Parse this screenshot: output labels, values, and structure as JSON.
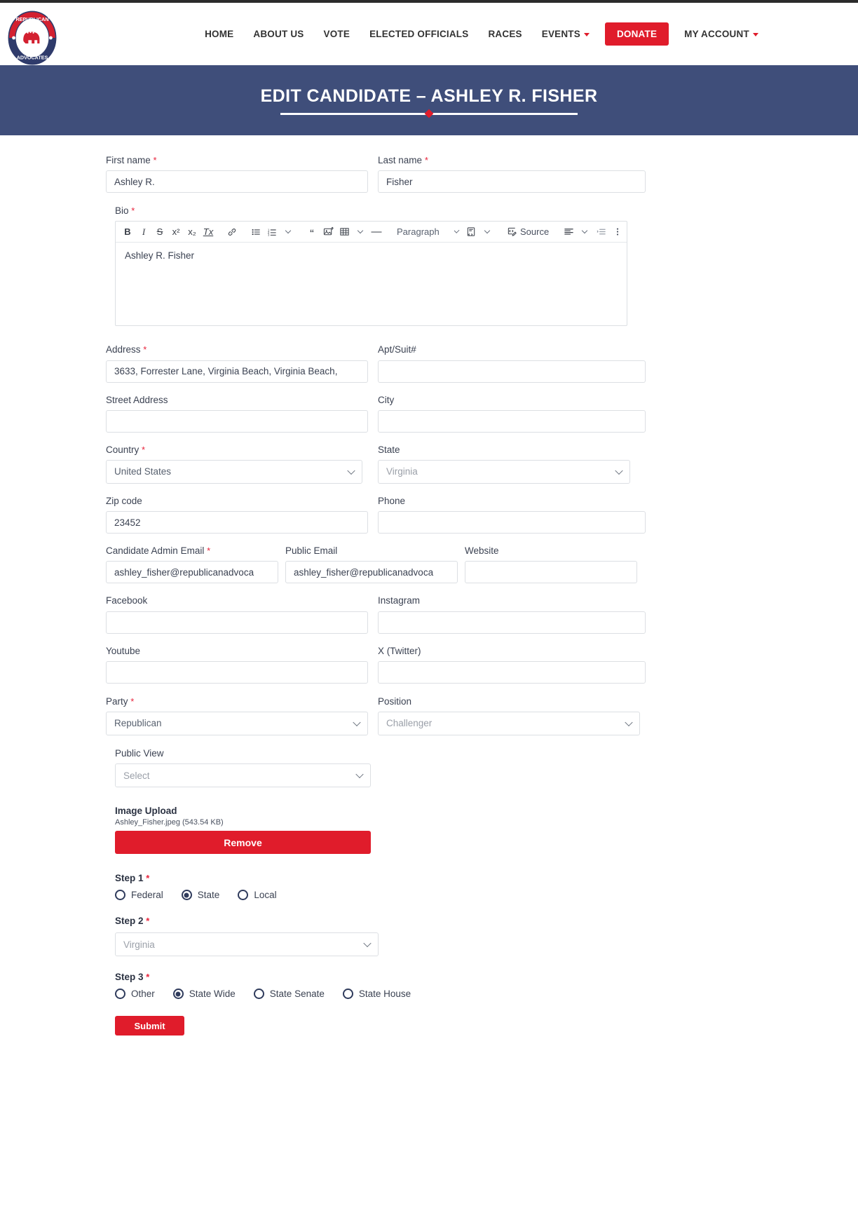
{
  "site": {
    "logo": {
      "top_text": "REPUBLICAN",
      "bottom_text": "ADVOCATES",
      "icon": "elephant-icon"
    },
    "nav": [
      {
        "label": "HOME",
        "has_caret": false
      },
      {
        "label": "ABOUT US",
        "has_caret": false
      },
      {
        "label": "VOTE",
        "has_caret": false
      },
      {
        "label": "ELECTED OFFICIALS",
        "has_caret": false
      },
      {
        "label": "RACES",
        "has_caret": false
      },
      {
        "label": "EVENTS",
        "has_caret": true
      },
      {
        "label": "DONATE",
        "has_caret": false,
        "style": "donate"
      },
      {
        "label": "MY ACCOUNT",
        "has_caret": true
      }
    ]
  },
  "banner": {
    "title": "EDIT CANDIDATE – ASHLEY R. FISHER",
    "bg_color": "#3f4e7a",
    "accent_color": "#e01c2b"
  },
  "form": {
    "first_name": {
      "label": "First name",
      "required": true,
      "value": "Ashley R."
    },
    "last_name": {
      "label": "Last name",
      "required": true,
      "value": "Fisher"
    },
    "bio": {
      "label": "Bio",
      "required": true,
      "content": "Ashley R. Fisher",
      "toolbar": {
        "buttons": [
          {
            "name": "bold-icon",
            "glyph": "B"
          },
          {
            "name": "italic-icon",
            "glyph": "I"
          },
          {
            "name": "strikethrough-icon",
            "glyph": "S"
          },
          {
            "name": "superscript-icon",
            "glyph": "x²"
          },
          {
            "name": "subscript-icon",
            "glyph": "x₂"
          },
          {
            "name": "remove-format-icon",
            "glyph": "Tx"
          },
          {
            "name": "link-icon",
            "glyph": "⧉"
          },
          {
            "name": "bulleted-list-icon",
            "glyph": "☰"
          },
          {
            "name": "numbered-list-icon",
            "glyph": "≣"
          },
          {
            "name": "list-options-chevron-icon",
            "glyph": "⌄"
          },
          {
            "name": "block-quote-icon",
            "glyph": "“"
          },
          {
            "name": "insert-image-icon",
            "glyph": "Ὓc"
          },
          {
            "name": "insert-table-icon",
            "glyph": "▦"
          },
          {
            "name": "table-options-chevron-icon",
            "glyph": "⌄"
          },
          {
            "name": "horizontal-line-icon",
            "glyph": "—"
          }
        ],
        "paragraph_dropdown": "Paragraph",
        "template_icon": "template-icon",
        "source_label": "Source",
        "alignment_icon": "text-align-icon",
        "indent_icon": "indent-icon",
        "more_options_icon": "vertical-dots-icon"
      }
    },
    "address": {
      "label": "Address",
      "required": true,
      "value": "3633, Forrester Lane, Virginia Beach, Virginia Beach,"
    },
    "apt": {
      "label": "Apt/Suit#",
      "required": false,
      "value": ""
    },
    "street_address": {
      "label": "Street Address",
      "required": false,
      "value": ""
    },
    "city": {
      "label": "City",
      "required": false,
      "value": ""
    },
    "country": {
      "label": "Country",
      "required": true,
      "value": "United States"
    },
    "state": {
      "label": "State",
      "required": false,
      "value": "Virginia",
      "muted": true
    },
    "zip": {
      "label": "Zip code",
      "required": false,
      "value": "23452"
    },
    "phone": {
      "label": "Phone",
      "required": false,
      "value": ""
    },
    "admin_email": {
      "label": "Candidate Admin Email",
      "required": true,
      "value": "ashley_fisher@republicanadvoca"
    },
    "public_email": {
      "label": "Public Email",
      "required": false,
      "value": "ashley_fisher@republicanadvoca"
    },
    "website": {
      "label": "Website",
      "required": false,
      "value": ""
    },
    "facebook": {
      "label": "Facebook",
      "required": false,
      "value": ""
    },
    "instagram": {
      "label": "Instagram",
      "required": false,
      "value": ""
    },
    "youtube": {
      "label": "Youtube",
      "required": false,
      "value": ""
    },
    "twitter": {
      "label": "X (Twitter)",
      "required": false,
      "value": ""
    },
    "party": {
      "label": "Party",
      "required": true,
      "value": "Republican"
    },
    "position": {
      "label": "Position",
      "required": false,
      "value": "Challenger",
      "muted": true
    },
    "public_view": {
      "label": "Public View",
      "required": false,
      "value": "Select",
      "muted": true
    },
    "image_upload": {
      "label": "Image Upload",
      "file_name": "Ashley_Fisher.jpeg (543.54 KB)",
      "remove_label": "Remove"
    },
    "step1": {
      "label": "Step 1",
      "required": true,
      "options": [
        {
          "label": "Federal",
          "checked": false
        },
        {
          "label": "State",
          "checked": true
        },
        {
          "label": "Local",
          "checked": false
        }
      ]
    },
    "step2": {
      "label": "Step 2",
      "required": true,
      "value": "Virginia",
      "muted": true
    },
    "step3": {
      "label": "Step 3",
      "required": true,
      "options": [
        {
          "label": "Other",
          "checked": false
        },
        {
          "label": "State Wide",
          "checked": true
        },
        {
          "label": "State Senate",
          "checked": false
        },
        {
          "label": "State House",
          "checked": false
        }
      ]
    },
    "submit": {
      "label": "Submit"
    }
  }
}
